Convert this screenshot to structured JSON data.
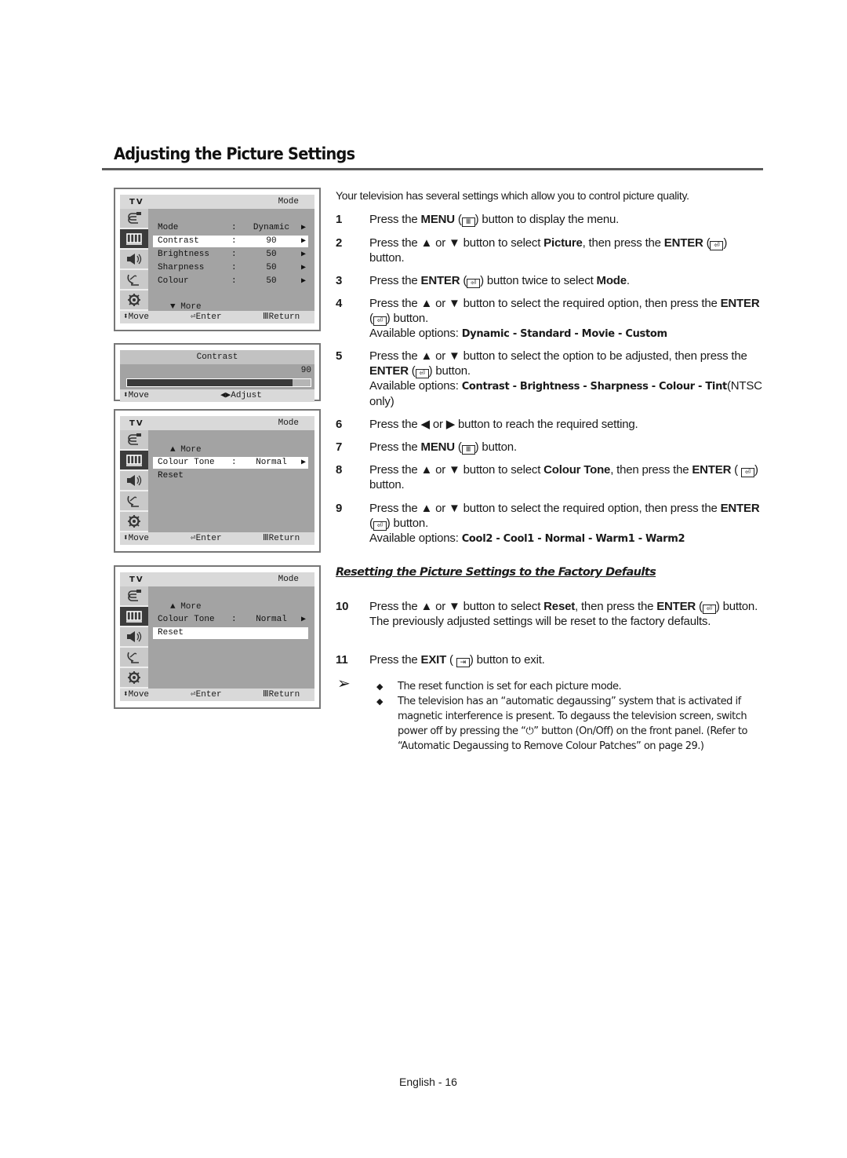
{
  "page": {
    "title": "Adjusting the Picture Settings",
    "footer": "English - 16"
  },
  "osd_common": {
    "tv_label": "TV",
    "header_right": "Mode",
    "footer_move": "Move",
    "footer_enter": "Enter",
    "footer_return": "Return",
    "sidebar_icons": [
      "input-icon",
      "picture-icon",
      "sound-icon",
      "channel-icon",
      "setup-icon"
    ],
    "active_sidebar_index": 1
  },
  "osd1": {
    "rows": [
      {
        "label": "Mode",
        "colon": ":",
        "value": "Dynamic",
        "arrow": "▶",
        "selected": false
      },
      {
        "label": "Contrast",
        "colon": ":",
        "value": "90",
        "arrow": "▶",
        "selected": true
      },
      {
        "label": "Brightness",
        "colon": ":",
        "value": "50",
        "arrow": "▶",
        "selected": false
      },
      {
        "label": "Sharpness",
        "colon": ":",
        "value": "50",
        "arrow": "▶",
        "selected": false
      },
      {
        "label": "Colour",
        "colon": ":",
        "value": "50",
        "arrow": "▶",
        "selected": false
      }
    ],
    "more": "▼ More"
  },
  "osd_bar": {
    "title": "Contrast",
    "value": "90",
    "level_percent": 90,
    "footer_move": "Move",
    "footer_adjust": "Adjust"
  },
  "osd3": {
    "more": "▲ More",
    "rows": [
      {
        "label": "Colour Tone",
        "colon": ":",
        "value": "Normal",
        "arrow": "▶",
        "selected": true
      },
      {
        "label": "Reset",
        "colon": "",
        "value": "",
        "arrow": "",
        "selected": false
      }
    ]
  },
  "osd4": {
    "more": "▲ More",
    "rows": [
      {
        "label": "Colour Tone",
        "colon": ":",
        "value": "Normal",
        "arrow": "▶",
        "selected": false
      },
      {
        "label": "Reset",
        "colon": "",
        "value": "",
        "arrow": "",
        "selected": true
      }
    ]
  },
  "content": {
    "intro": "Your television has several settings which allow you to control picture quality.",
    "steps": [
      {
        "num": "1",
        "text": "Press the <b>MENU</b> (<k>m</k>) button to display the menu."
      },
      {
        "num": "2",
        "text": "Press the ▲ or ▼ button to select <b>Picture</b>, then press the <b>ENTER</b> (<k>e</k>) button."
      },
      {
        "num": "3",
        "text": "Press the <b>ENTER</b> (<k>e</k>) button twice to select <b>Mode</b>."
      },
      {
        "num": "4",
        "text": "Press the ▲ or ▼ button to select the required option, then press the <b>ENTER</b> (<k>e</k>) button.",
        "options": "Dynamic - Standard - Movie - Custom"
      },
      {
        "num": "5",
        "text": "Press the ▲ or ▼ button to select the option to be adjusted, then press the <b>ENTER</b> (<k>e</k>) button.",
        "options": "Contrast - Brightness - Sharpness - Colour - ",
        "options_tail_bold": "Tint",
        "options_tail": "(NTSC only)"
      },
      {
        "num": "6",
        "text": "Press the ◀ or ▶ button to reach the required setting."
      },
      {
        "num": "7",
        "text": "Press the <b>MENU</b> (<k>m</k>) button."
      },
      {
        "num": "8",
        "text": "Press the ▲ or ▼ button to select <b>Colour Tone</b>, then press the <b>ENTER</b> ( <k>e</k>) button."
      },
      {
        "num": "9",
        "text": "Press the ▲ or ▼ button to select the required option, then press the <b>ENTER</b> (<k>e</k>) button.",
        "options": "Cool2 - Cool1 - Normal - Warm1 - Warm2"
      }
    ],
    "available_options_label": "Available options: ",
    "subheading": "Resetting the Picture Settings to the Factory Defaults",
    "steps2": [
      {
        "num": "10",
        "text": "Press the ▲ or ▼ button to select <b>Reset</b>, then press the <b>ENTER</b> (<k>e</k>) button.",
        "extra": "The previously adjusted settings will be reset to the factory defaults."
      },
      {
        "num": "11",
        "text": "Press the <b>EXIT</b> ( <k>x</k>) button to exit."
      }
    ],
    "notes": [
      "The reset function is set for each picture mode.",
      "The television has an “automatic degaussing” system that is activated if magnetic interference is present. To degauss the television screen, switch power off by pressing the “⏻” button (On/Off) on the front panel. (Refer to “Automatic Degaussing to Remove Colour Patches” on page 29.)"
    ]
  }
}
